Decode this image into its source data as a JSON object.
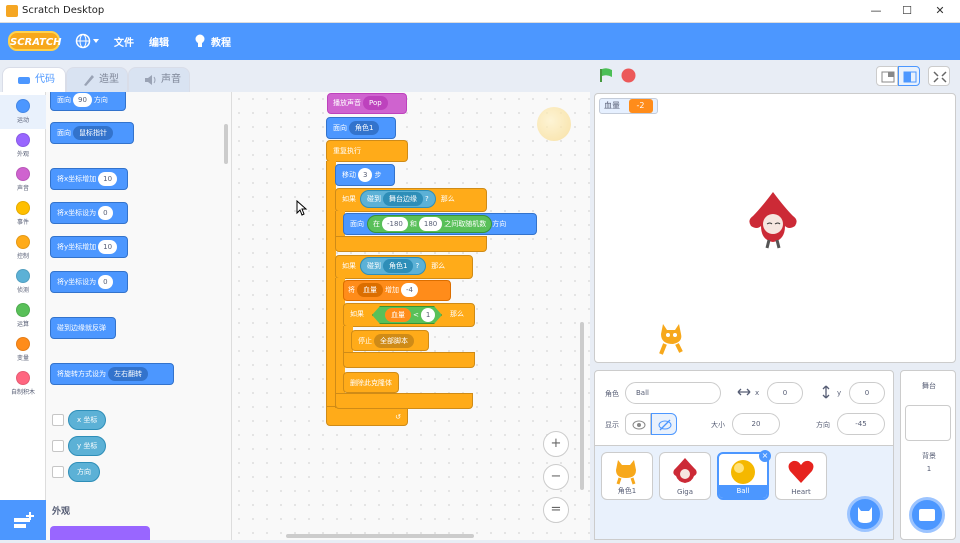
{
  "window": {
    "title": "Scratch Desktop",
    "min": "—",
    "max": "☐",
    "close": "✕"
  },
  "menu": {
    "logo": "SCRATCH",
    "file": "文件",
    "edit": "编辑",
    "tutorials": "教程"
  },
  "tabs": {
    "code": "代码",
    "costumes": "造型",
    "sounds": "声音"
  },
  "categories": [
    {
      "label": "运动",
      "color": "#4c97ff"
    },
    {
      "label": "外观",
      "color": "#9966ff"
    },
    {
      "label": "声音",
      "color": "#cf63cf"
    },
    {
      "label": "事件",
      "color": "#ffbf00"
    },
    {
      "label": "控制",
      "color": "#ffab19"
    },
    {
      "label": "侦测",
      "color": "#5cb1d6"
    },
    {
      "label": "运算",
      "color": "#59c059"
    },
    {
      "label": "变量",
      "color": "#ff8c1a"
    },
    {
      "label": "自制积木",
      "color": "#ff6680"
    }
  ],
  "palette": {
    "point_dir": {
      "a": "面向",
      "v": "90",
      "b": "方向"
    },
    "point_to": {
      "a": "面向",
      "v": "鼠标指针"
    },
    "change_x": {
      "a": "将x坐标增加",
      "v": "10"
    },
    "set_x": {
      "a": "将x坐标设为",
      "v": "0"
    },
    "change_y": {
      "a": "将y坐标增加",
      "v": "10"
    },
    "set_y": {
      "a": "将y坐标设为",
      "v": "0"
    },
    "bounce": "碰到边缘就反弹",
    "rot": {
      "a": "将旋转方式设为",
      "v": "左右翻转"
    },
    "xpos": "x 坐标",
    "ypos": "y 坐标",
    "dir": "方向",
    "looks_header": "外观"
  },
  "script": {
    "play_sound": {
      "a": "播放声音",
      "v": "Pop"
    },
    "point_to": {
      "a": "面向",
      "v": "角色1"
    },
    "forever": "重复执行",
    "move": {
      "a": "移动",
      "v": "3",
      "b": "步"
    },
    "if1": {
      "a": "如果",
      "b": "碰到",
      "v": "舞台边缘",
      "q": "?",
      "c": "那么"
    },
    "point_rand": {
      "a": "面向",
      "b": "在",
      "v1": "-180",
      "c": "和",
      "v2": "180",
      "d": "之间取随机数",
      "e": "方向"
    },
    "if2": {
      "a": "如果",
      "b": "碰到",
      "v": "角色1",
      "q": "?",
      "c": "那么"
    },
    "change_var": {
      "a": "将",
      "v": "血量",
      "b": "增加",
      "n": "-4"
    },
    "if3": {
      "a": "如果",
      "v": "血量",
      "op": "<",
      "n": "1",
      "c": "那么"
    },
    "stop": {
      "a": "停止",
      "v": "全部脚本"
    },
    "delete_clone": "删除此克隆体"
  },
  "zoom": {
    "in": "+",
    "out": "−",
    "reset": "="
  },
  "stage": {
    "var_label": "血量",
    "var_value": "-2"
  },
  "sprite_info": {
    "sprite_label": "角色",
    "sprite_name": "Ball",
    "x_label": "x",
    "x_value": "0",
    "y_label": "y",
    "y_value": "0",
    "show_label": "显示",
    "size_label": "大小",
    "size_value": "20",
    "direction_label": "方向",
    "direction_value": "-45"
  },
  "sprites": [
    {
      "name": "角色1"
    },
    {
      "name": "Giga"
    },
    {
      "name": "Ball"
    },
    {
      "name": "Heart"
    }
  ],
  "backdrop": {
    "title": "舞台",
    "label": "背景",
    "count": "1"
  },
  "colors": {
    "accent": "#4c97ff",
    "control": "#ffab19",
    "sensing": "#5cb1d6",
    "operators": "#59c059",
    "variables": "#ff8c1a",
    "sound": "#cf63cf"
  }
}
